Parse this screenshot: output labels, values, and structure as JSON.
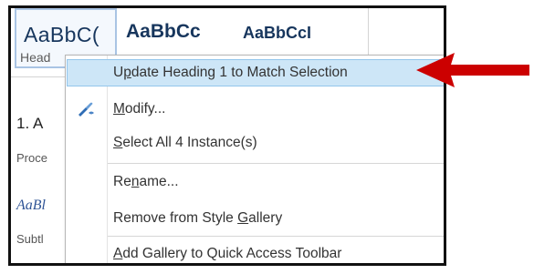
{
  "gallery": {
    "tiles": [
      {
        "sample": "AaBbC(",
        "name": "Head"
      },
      {
        "sample": "AaBbCc"
      },
      {
        "sample": "AaBbCcI"
      }
    ]
  },
  "pane": {
    "line1": "1.  A",
    "line2": "Proce",
    "line3": "AaBl",
    "line4": "Subtl"
  },
  "context_menu": {
    "items": [
      {
        "parts": [
          "U",
          "p",
          "date Heading 1 to Match Selection"
        ],
        "highlighted": true
      },
      {
        "parts": [
          "",
          "M",
          "odify..."
        ],
        "icon": "modify-brush-icon"
      },
      {
        "parts": [
          "",
          "S",
          "elect All 4 Instance(s)"
        ]
      },
      {
        "parts": [
          "Re",
          "n",
          "ame..."
        ]
      },
      {
        "parts": [
          "Remove from Style ",
          "G",
          "allery"
        ]
      },
      {
        "parts": [
          "",
          "A",
          "dd Gallery to Quick Access Toolbar"
        ]
      }
    ]
  },
  "colors": {
    "highlight_bg": "#cde6f7",
    "highlight_border": "#93c6ec",
    "arrow": "#cc0000",
    "heading_text": "#17365d"
  }
}
